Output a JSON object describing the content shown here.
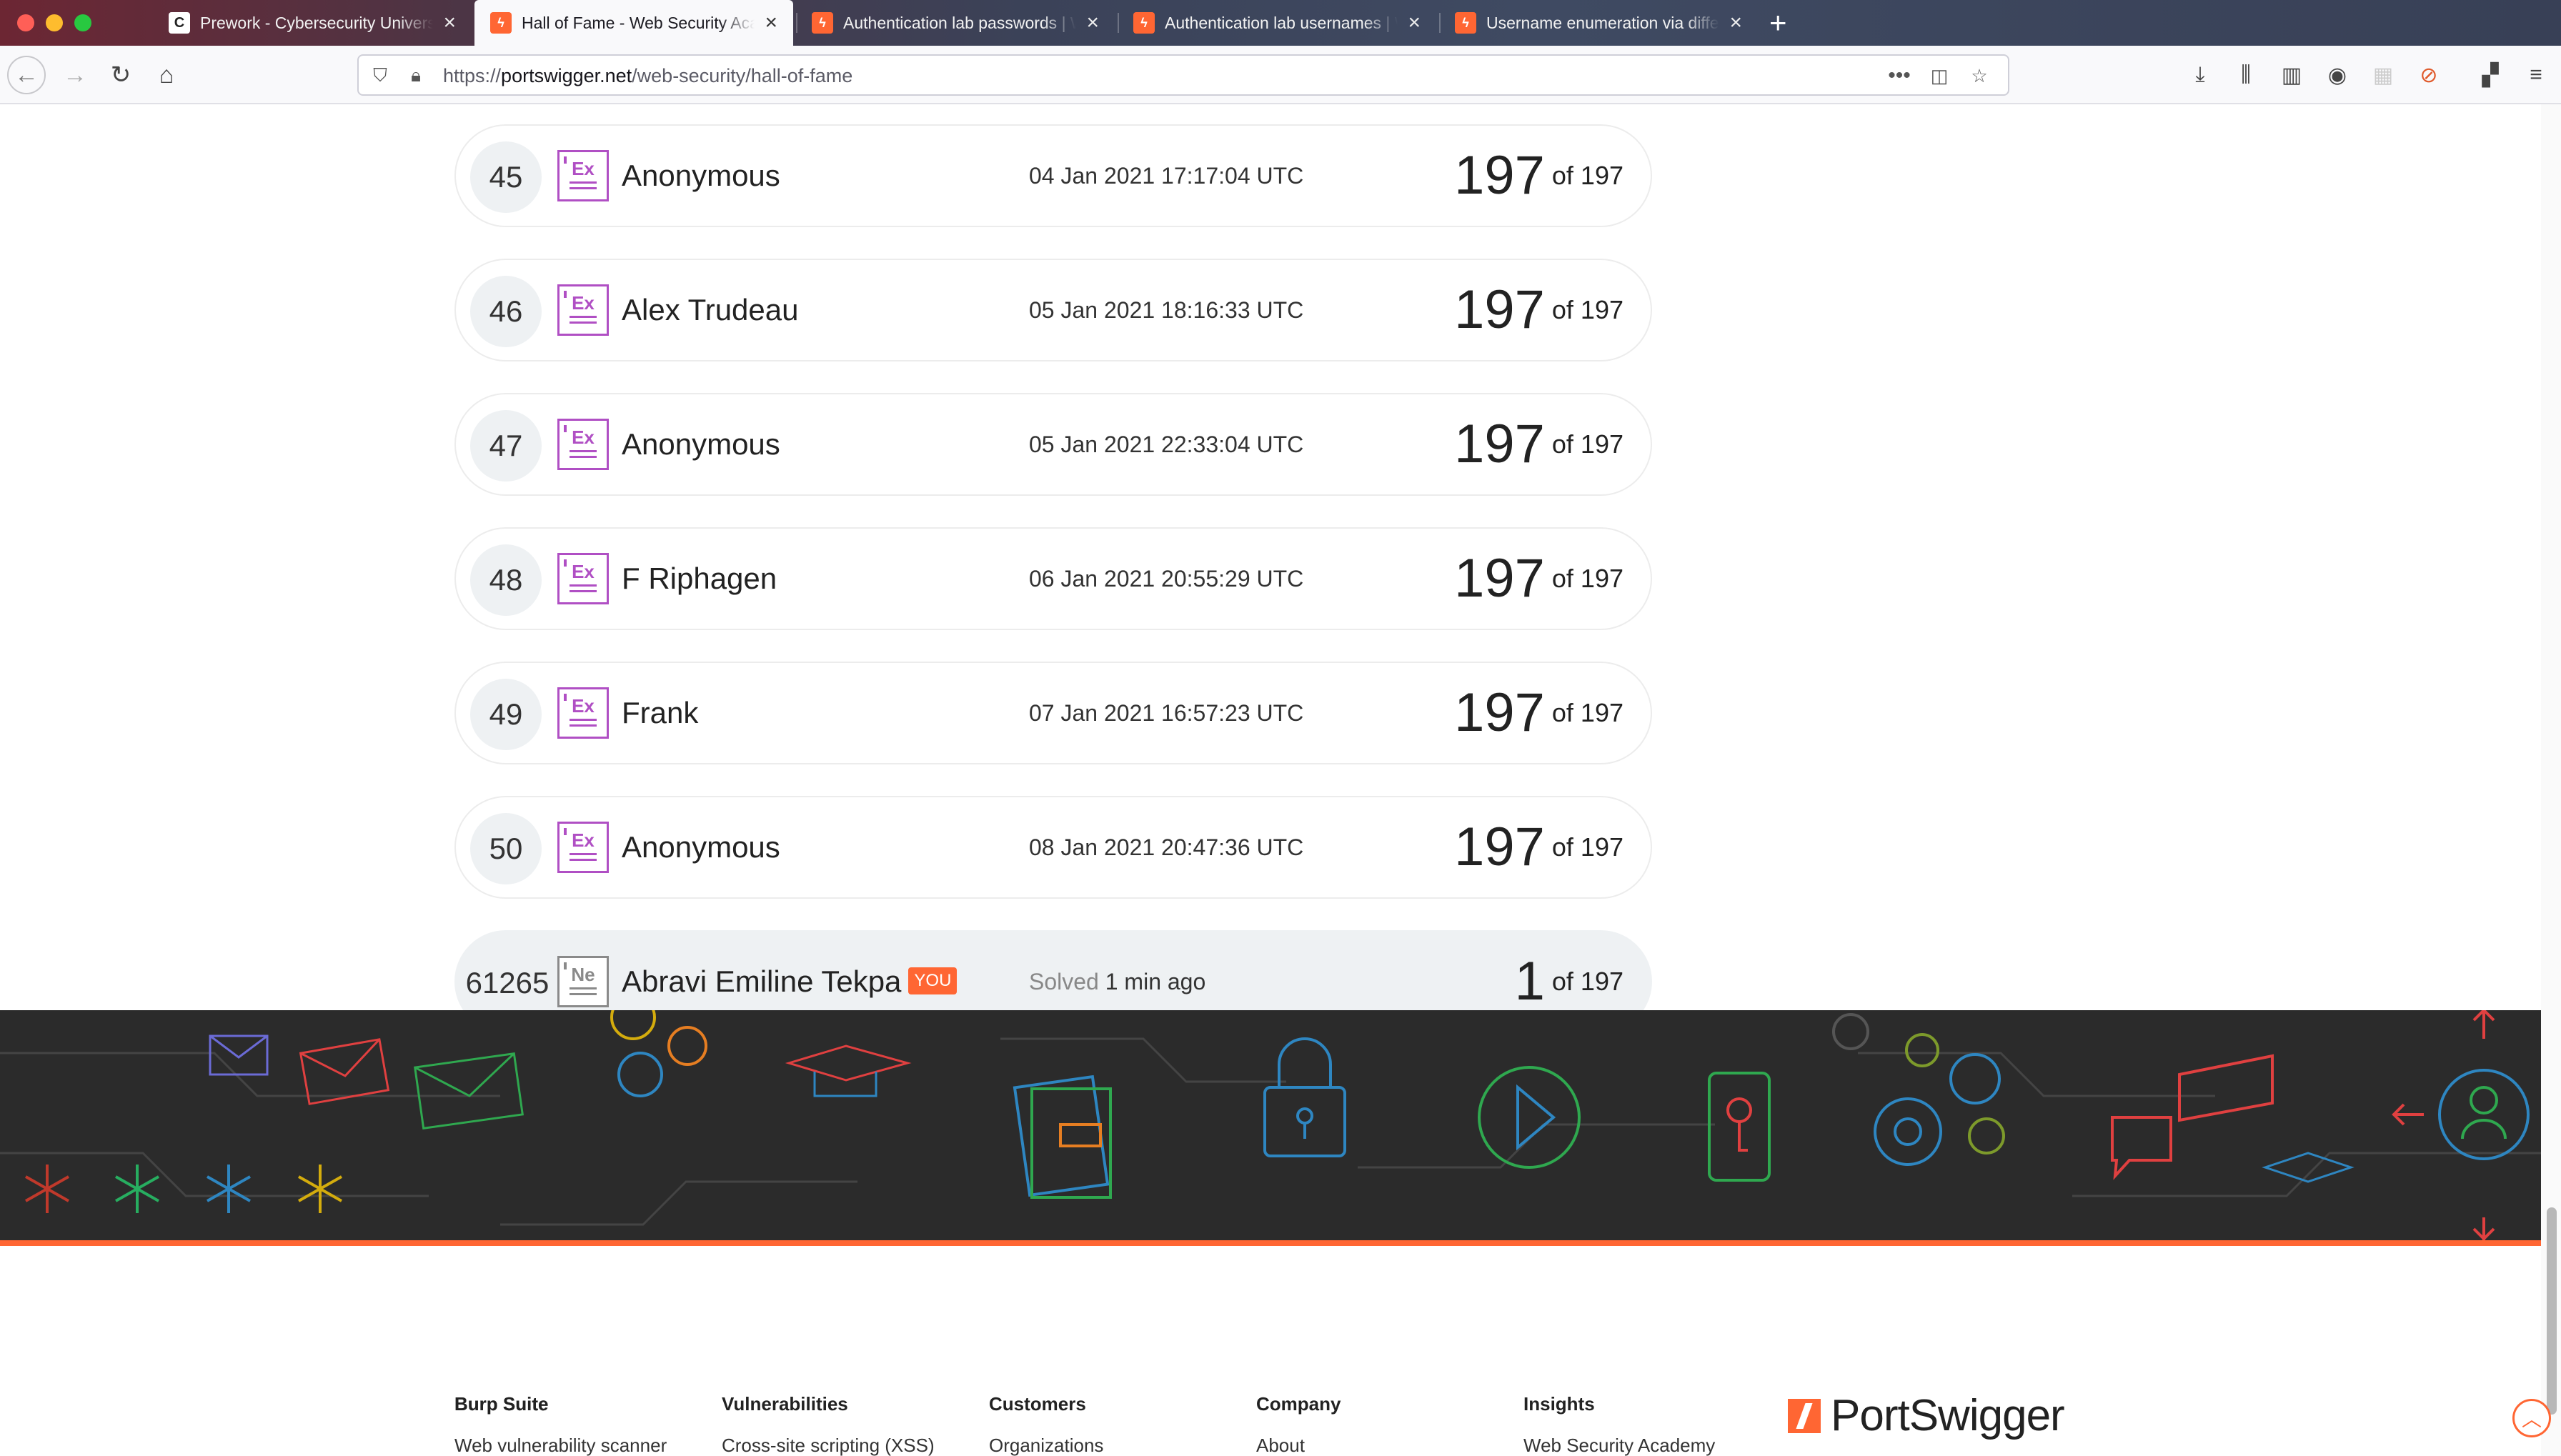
{
  "browser": {
    "tabs": [
      {
        "title": "Prework - Cybersecurity University",
        "favicon": "c-logo-icon",
        "active": false
      },
      {
        "title": "Hall of Fame - Web Security Academy",
        "favicon": "portswigger-icon",
        "active": true
      },
      {
        "title": "Authentication lab passwords | Web Security Academy",
        "favicon": "portswigger-icon",
        "active": false
      },
      {
        "title": "Authentication lab usernames | Web Security Academy",
        "favicon": "portswigger-icon",
        "active": false
      },
      {
        "title": "Username enumeration via different responses",
        "favicon": "portswigger-icon",
        "active": false
      }
    ],
    "url": {
      "scheme": "https://",
      "host": "portswigger.net",
      "path": "/web-security/hall-of-fame"
    }
  },
  "leaderboard": {
    "rows": [
      {
        "rank": "45",
        "level": "Ex",
        "name": "Anonymous",
        "date": "04 Jan 2021 17:17:04 UTC",
        "score": "197",
        "of": "of 197"
      },
      {
        "rank": "46",
        "level": "Ex",
        "name": "Alex Trudeau",
        "date": "05 Jan 2021 18:16:33 UTC",
        "score": "197",
        "of": "of 197"
      },
      {
        "rank": "47",
        "level": "Ex",
        "name": "Anonymous",
        "date": "05 Jan 2021 22:33:04 UTC",
        "score": "197",
        "of": "of 197"
      },
      {
        "rank": "48",
        "level": "Ex",
        "name": "F Riphagen",
        "date": "06 Jan 2021 20:55:29 UTC",
        "score": "197",
        "of": "of 197"
      },
      {
        "rank": "49",
        "level": "Ex",
        "name": "Frank",
        "date": "07 Jan 2021 16:57:23 UTC",
        "score": "197",
        "of": "of 197"
      },
      {
        "rank": "50",
        "level": "Ex",
        "name": "Anonymous",
        "date": "08 Jan 2021 20:47:36 UTC",
        "score": "197",
        "of": "of 197"
      }
    ],
    "you": {
      "rank": "61265",
      "level": "Ne",
      "name": "Abravi Emiline Tekpa",
      "badge": "YOU",
      "solved_label": "Solved",
      "solved_ago": "1 min ago",
      "score": "1",
      "of": "of 197"
    }
  },
  "footer": {
    "columns": [
      {
        "heading": "Burp Suite",
        "link": "Web vulnerability scanner"
      },
      {
        "heading": "Vulnerabilities",
        "link": "Cross-site scripting (XSS)"
      },
      {
        "heading": "Customers",
        "link": "Organizations"
      },
      {
        "heading": "Company",
        "link": "About"
      },
      {
        "heading": "Insights",
        "link": "Web Security Academy"
      }
    ],
    "logo_text": "PortSwigger"
  },
  "colors": {
    "brand_orange": "#ff6633",
    "expert_purple": "#b04fc4",
    "banner_bg": "#2b2b2b"
  }
}
